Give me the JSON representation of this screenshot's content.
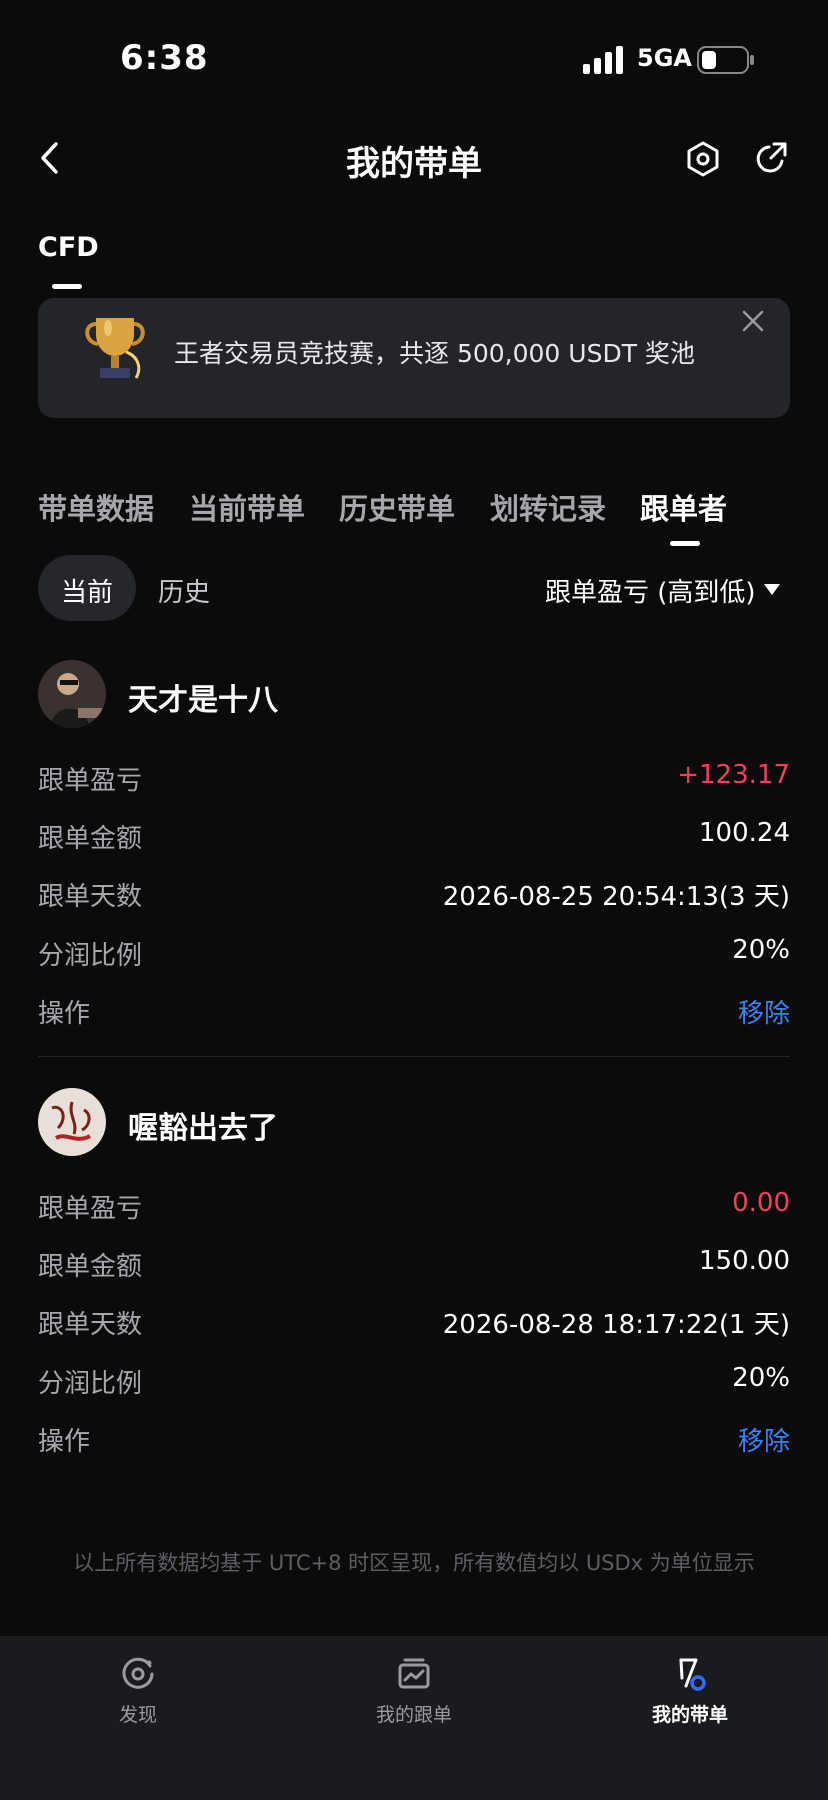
{
  "status": {
    "time": "6:38",
    "network": "5GA"
  },
  "header": {
    "title": "我的带单"
  },
  "cfd_tab": {
    "label": "CFD"
  },
  "banner": {
    "text": "王者交易员竞技赛，共逐 500,000 USDT 奖池"
  },
  "tabs": [
    "带单数据",
    "当前带单",
    "历史带单",
    "划转记录",
    "跟单者"
  ],
  "active_tab": "跟单者",
  "subtabs": {
    "current": "当前",
    "history": "历史"
  },
  "sort": {
    "label": "跟单盈亏 (高到低)"
  },
  "followers": [
    {
      "name": "天才是十八",
      "rows": [
        {
          "label": "跟单盈亏",
          "value": "+123.17"
        },
        {
          "label": "跟单金额",
          "value": "100.24"
        },
        {
          "label": "跟单天数",
          "value": "2026-08-25 20:54:13(3 天)"
        },
        {
          "label": "分润比例",
          "value": "20%"
        },
        {
          "label": "操作",
          "value": "移除"
        }
      ]
    },
    {
      "name": "喔豁出去了",
      "rows": [
        {
          "label": "跟单盈亏",
          "value": "0.00"
        },
        {
          "label": "跟单金额",
          "value": "150.00"
        },
        {
          "label": "跟单天数",
          "value": "2026-08-28 18:17:22(1 天)"
        },
        {
          "label": "分润比例",
          "value": "20%"
        },
        {
          "label": "操作",
          "value": "移除"
        }
      ]
    }
  ],
  "footnote": "以上所有数据均基于 UTC+8 时区呈现，所有数值均以 USDx 为单位显示",
  "bottom_nav": [
    {
      "label": "发现",
      "icon": "discover-icon"
    },
    {
      "label": "我的跟单",
      "icon": "copy-trade-icon"
    },
    {
      "label": "我的带单",
      "icon": "lead-trade-icon"
    }
  ],
  "colors": {
    "background": "#0b0b0c",
    "profit": "#f0405a",
    "link": "#3b82f6",
    "nav_active_dot": "#2f6bff"
  }
}
